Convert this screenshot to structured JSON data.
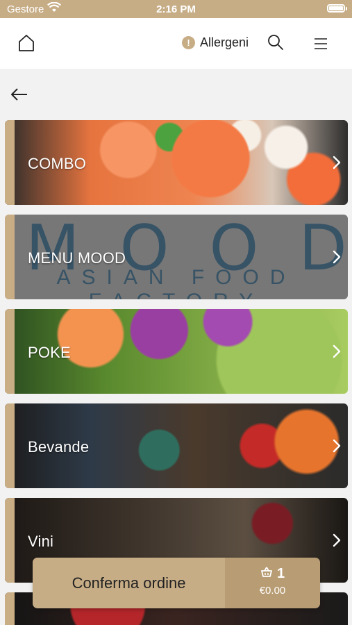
{
  "status_bar": {
    "carrier": "Gestore",
    "time": "2:16 PM"
  },
  "header": {
    "allergens_label": "Allergeni"
  },
  "categories": [
    {
      "label": "COMBO"
    },
    {
      "label": "MENU MOOD",
      "image_text": "MOOD",
      "image_subtext": "ASIAN FOOD FACTORY"
    },
    {
      "label": "POKE"
    },
    {
      "label": "Bevande"
    },
    {
      "label": "Vini"
    },
    {
      "label": ""
    }
  ],
  "order": {
    "confirm_label": "Conferma ordine",
    "item_count": "1",
    "total": "€0.00"
  },
  "colors": {
    "accent": "#c7ad86",
    "accent_dark": "#b89c73",
    "background": "#f2f2f2"
  }
}
